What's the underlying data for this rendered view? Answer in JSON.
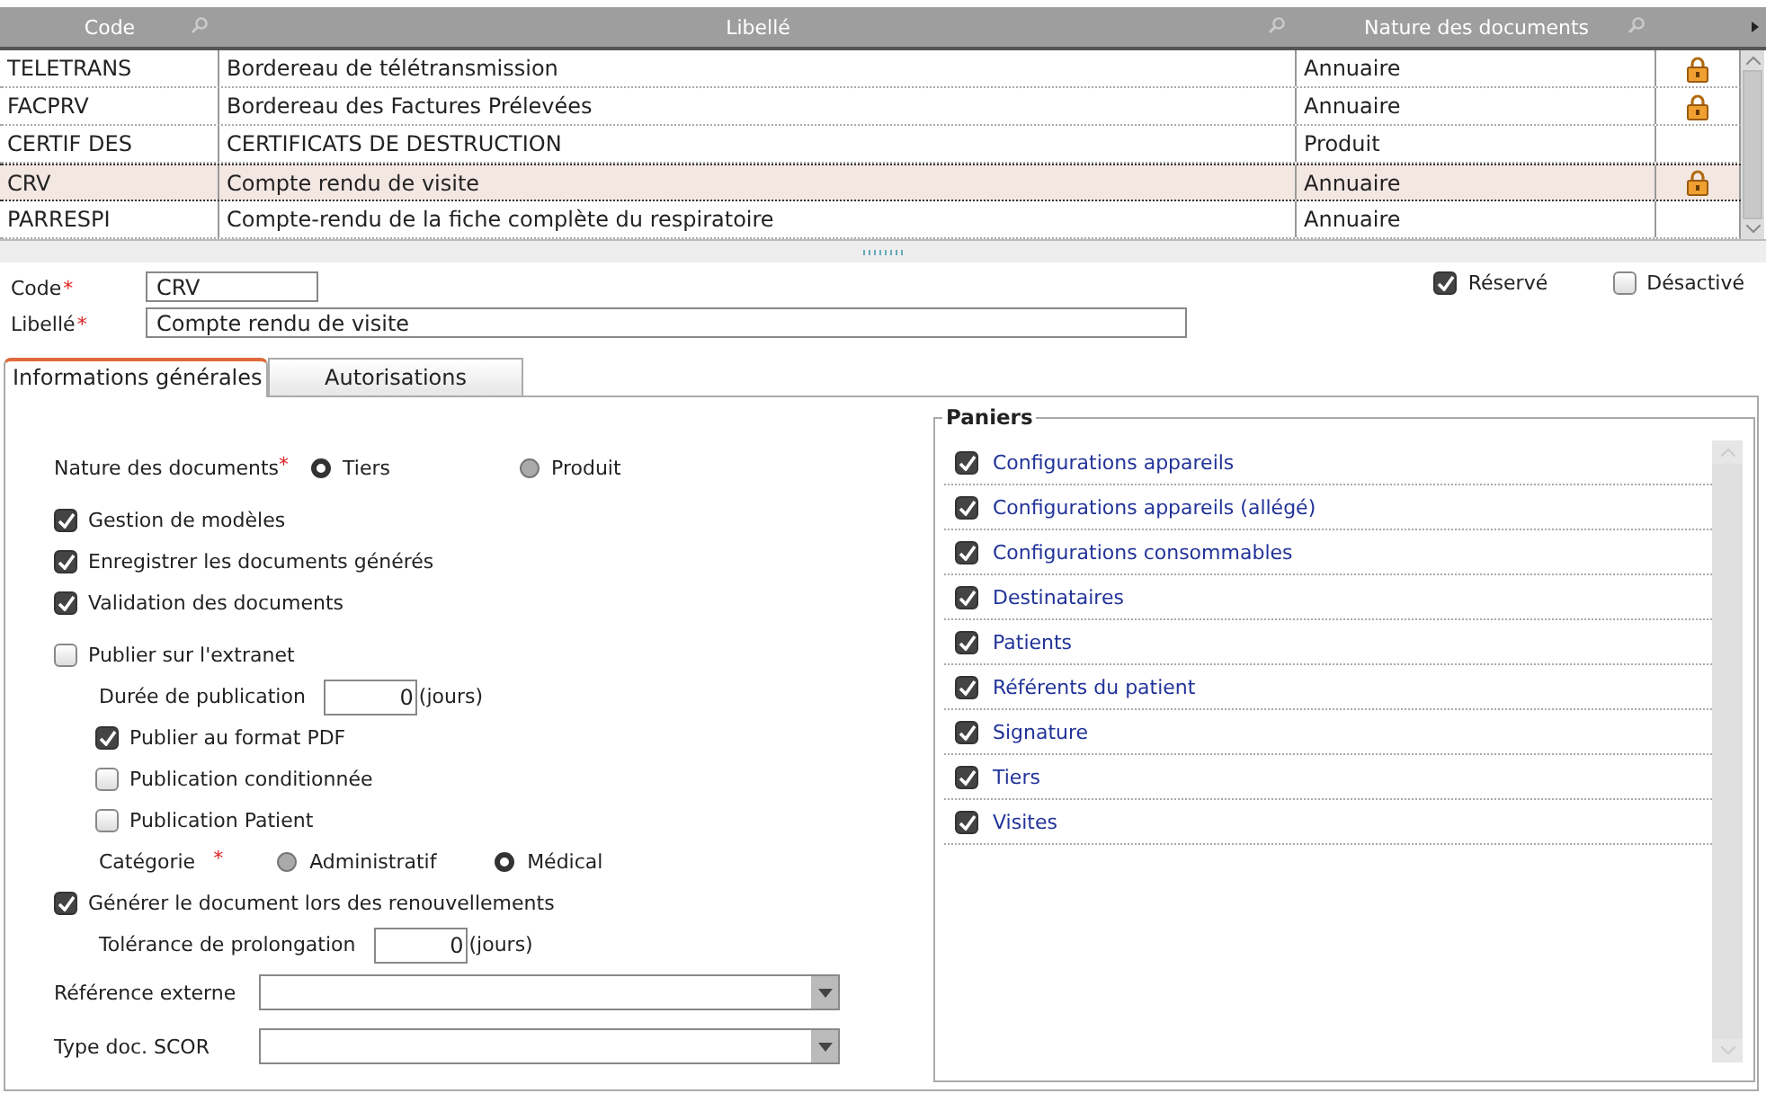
{
  "table": {
    "columns": [
      {
        "label": "Code"
      },
      {
        "label": "Libellé"
      },
      {
        "label": "Nature des documents"
      }
    ],
    "rows": [
      {
        "code": "TELETRANS",
        "libelle": "Bordereau de télétransmission",
        "nature": "Annuaire",
        "locked": true,
        "selected": false
      },
      {
        "code": "FACPRV",
        "libelle": "Bordereau des Factures Prélevées",
        "nature": "Annuaire",
        "locked": true,
        "selected": false
      },
      {
        "code": "CERTIF DES",
        "libelle": "CERTIFICATS DE DESTRUCTION",
        "nature": "Produit",
        "locked": false,
        "selected": false
      },
      {
        "code": "CRV",
        "libelle": "Compte rendu de visite",
        "nature": "Annuaire",
        "locked": true,
        "selected": true
      },
      {
        "code": "PARRESPI",
        "libelle": "Compte-rendu de la fiche complète du respiratoire",
        "nature": "Annuaire",
        "locked": false,
        "selected": false
      }
    ]
  },
  "form": {
    "code": {
      "label": "Code",
      "mark": "*",
      "value": "CRV"
    },
    "libelle": {
      "label": "Libellé",
      "mark": "*",
      "value": "Compte rendu de visite"
    },
    "flags": [
      {
        "label": "Réservé",
        "checked": true
      },
      {
        "label": "Désactivé",
        "checked": false
      }
    ]
  },
  "tabs": [
    {
      "label": "Informations générales",
      "selected": true
    },
    {
      "label": "Autorisations",
      "selected": false
    }
  ],
  "general": [
    {
      "kind": "radio",
      "label": "Nature des documents",
      "mark": "*",
      "options": [
        {
          "label": "Tiers",
          "selected": true
        },
        {
          "label": "Produit",
          "selected": false
        }
      ]
    },
    {
      "kind": "checkbox",
      "label": "Gestion de modèles",
      "checked": true
    },
    {
      "kind": "checkbox",
      "label": "Enregistrer les documents générés",
      "checked": true
    },
    {
      "kind": "checkbox",
      "label": "Validation des documents",
      "checked": true
    },
    {
      "kind": "checkbox",
      "label": "Publier sur l'extranet",
      "checked": false,
      "children": [
        {
          "kind": "number",
          "label": "Durée de publication",
          "value": "0",
          "unit": "(jours)"
        },
        {
          "kind": "checkbox",
          "label": "Publier au format PDF",
          "checked": true
        },
        {
          "kind": "checkbox",
          "label": "Publication conditionnée",
          "checked": false
        },
        {
          "kind": "checkbox",
          "label": "Publication Patient",
          "checked": false
        },
        {
          "kind": "radio",
          "label": "Catégorie",
          "mark": "*",
          "options": [
            {
              "label": "Administratif",
              "selected": false
            },
            {
              "label": "Médical",
              "selected": true
            }
          ]
        }
      ]
    },
    {
      "kind": "checkbox",
      "label": "Générer le document lors des renouvellements",
      "checked": true,
      "children": [
        {
          "kind": "number",
          "label": "Tolérance de prolongation",
          "value": "0",
          "unit": "(jours)"
        }
      ]
    },
    {
      "kind": "select",
      "label": "Référence externe"
    },
    {
      "kind": "select",
      "label": "Type doc. SCOR"
    }
  ],
  "paniers": {
    "title": "Paniers",
    "items": [
      {
        "label": "Configurations appareils",
        "checked": true
      },
      {
        "label": "Configurations appareils (allégé)",
        "checked": true
      },
      {
        "label": "Configurations consommables",
        "checked": true
      },
      {
        "label": "Destinataires",
        "checked": true
      },
      {
        "label": "Patients",
        "checked": true
      },
      {
        "label": "Référents du patient",
        "checked": true
      },
      {
        "label": "Signature",
        "checked": true
      },
      {
        "label": "Tiers",
        "checked": true
      },
      {
        "label": "Visites",
        "checked": true
      }
    ]
  }
}
